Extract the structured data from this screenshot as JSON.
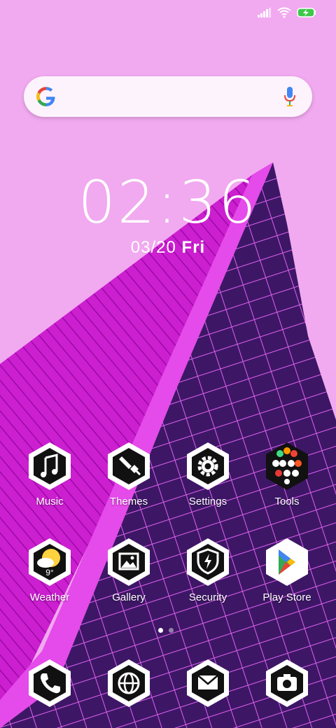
{
  "clock": {
    "time": "02:36",
    "date": "03/20",
    "day": "Fri"
  },
  "status_bar": {
    "icons": [
      "signal-icon",
      "wifi-icon",
      "battery-charging-icon"
    ]
  },
  "search": {
    "logo": "google-logo-icon",
    "voice": "mic-icon"
  },
  "apps": [
    {
      "label": "Music",
      "icon": "music-note-icon"
    },
    {
      "label": "Themes",
      "icon": "paintbrush-icon"
    },
    {
      "label": "Settings",
      "icon": "gear-icon"
    },
    {
      "label": "Tools",
      "icon": "tools-folder-icon"
    },
    {
      "label": "Weather",
      "icon": "weather-icon",
      "temperature": "9°"
    },
    {
      "label": "Gallery",
      "icon": "image-icon"
    },
    {
      "label": "Security",
      "icon": "shield-bolt-icon"
    },
    {
      "label": "Play Store",
      "icon": "play-store-icon"
    }
  ],
  "dock": [
    {
      "icon": "phone-icon"
    },
    {
      "icon": "globe-icon"
    },
    {
      "icon": "mail-icon"
    },
    {
      "icon": "camera-icon"
    }
  ],
  "page_indicator": {
    "pages": 2,
    "current": 1
  },
  "colors": {
    "background": "#f0a8ee",
    "building_magenta": "#cc22cc",
    "building_dark": "#3a1660"
  }
}
